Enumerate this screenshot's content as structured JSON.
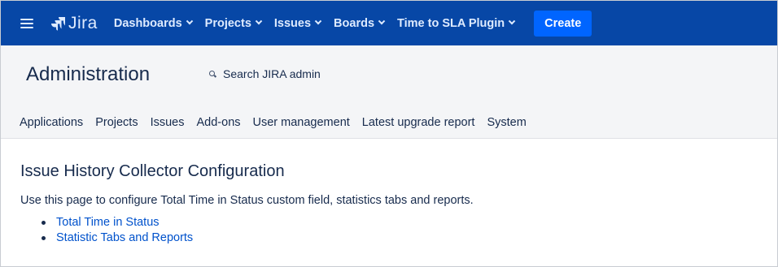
{
  "topnav": {
    "background": "#0747a6",
    "menu_icon": "hamburger-menu-icon",
    "logo_icon": "jira-logo-icon",
    "logo_text": "Jira",
    "items": [
      {
        "label": "Dashboards",
        "icon": "chevron-down-icon"
      },
      {
        "label": "Projects",
        "icon": "chevron-down-icon"
      },
      {
        "label": "Issues",
        "icon": "chevron-down-icon"
      },
      {
        "label": "Boards",
        "icon": "chevron-down-icon"
      },
      {
        "label": "Time to SLA Plugin",
        "icon": "chevron-down-icon"
      }
    ],
    "create_label": "Create",
    "create_color": "#0065ff"
  },
  "admin": {
    "title": "Administration",
    "search_placeholder": "Search JIRA admin",
    "search_icon": "search-icon",
    "tabs": [
      {
        "label": "Applications"
      },
      {
        "label": "Projects"
      },
      {
        "label": "Issues"
      },
      {
        "label": "Add-ons"
      },
      {
        "label": "User management"
      },
      {
        "label": "Latest upgrade report"
      },
      {
        "label": "System"
      }
    ]
  },
  "main": {
    "heading": "Issue History Collector Configuration",
    "description": "Use this page to configure Total Time in Status custom field, statistics tabs and reports.",
    "links": [
      {
        "label": "Total Time in Status"
      },
      {
        "label": "Statistic Tabs and Reports"
      }
    ],
    "link_color": "#0052cc"
  }
}
